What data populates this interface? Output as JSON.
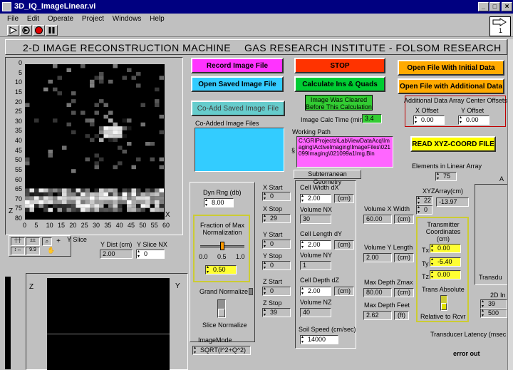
{
  "window": {
    "title": "3D_IQ_ImageLinear.vi",
    "controls": [
      "_",
      "□",
      "×"
    ]
  },
  "menu": [
    "File",
    "Edit",
    "Operate",
    "Project",
    "Windows",
    "Help"
  ],
  "connector_number": "1",
  "banner": {
    "left": "2-D IMAGE RECONSTRUCTION MACHINE",
    "right": "GAS RESEARCH INSTITUTE - FOLSOM RESEARCH"
  },
  "graph": {
    "y_ticks": [
      "0",
      "5",
      "10",
      "15",
      "20",
      "25",
      "30",
      "35",
      "40",
      "45",
      "50",
      "55",
      "60",
      "65",
      "70",
      "75",
      "80"
    ],
    "x_ticks": [
      "0",
      "5",
      "10",
      "15",
      "20",
      "25",
      "30",
      "35",
      "40",
      "45",
      "50",
      "55",
      "60"
    ],
    "x_axis": "X",
    "z_axis": "Z",
    "y_slice_label": "Y Slice",
    "y_dist_label": "Y Dist (cm)",
    "y_dist_value": "2.00",
    "y_slice_nx_label": "Y Slice NX",
    "y_slice_nx_value": "0"
  },
  "lower_graph": {
    "z_axis": "Z",
    "y_axis": "Y"
  },
  "buttons": {
    "record": "Record Image File",
    "stop": "STOP",
    "open_initial": "Open File With Initial Data",
    "open_saved": "Open Saved Image File",
    "calculate": "Calculate Ins & Quads",
    "open_additional": "Open File with Additional Data",
    "co_add": "Co-Add Saved Image File",
    "read_xyz": "READ XYZ-COORD FILE"
  },
  "image_cleared": "Image Was Cleared Before This Calculation",
  "image_calc_time_label": "Image Calc Time (min)",
  "image_calc_time_value": "3.4",
  "co_added_label": "Co-Added Image Files",
  "working_path_label": "Working Path",
  "working_path_value": "C:\\GRIProjects\\LabViewDataAcq\\Imaging\\ActiveImaging\\ImageFiles\\021099Imaging\\021099a1Img.Bin",
  "offsets": {
    "title": "Additional Data Array Center Offsets",
    "x_label": "X Offset",
    "x_value": "0.00",
    "y_label": "Y Offset",
    "y_value": "0.00"
  },
  "elements_label": "Elements in Linear Array",
  "elements_value": "75",
  "xyz_array_label": "XYZArray(cm)",
  "xyz_index_1": "22",
  "xyz_index_2": "0",
  "xyz_value": "-13.97",
  "dyn_rng_label": "Dyn Rng (db)",
  "dyn_rng_value": "8.00",
  "fraction": {
    "title": "Fraction of Max Normalization",
    "ticks": [
      "0.0",
      "0.5",
      "1.0"
    ],
    "value": "0.50",
    "fraction_value": 0.5
  },
  "grand_normalize": "Grand Normalize",
  "slice_normalize": "Slice Normalize",
  "image_mode_label": "ImageMode",
  "image_mode_value": "SQRT(I^2+Q^2)",
  "xyz_ranges": {
    "x_start_label": "X Start",
    "x_start": "0",
    "x_stop_label": "X Stop",
    "x_stop": "29",
    "y_start_label": "Y Start",
    "y_start": "0",
    "y_stop_label": "Y Stop",
    "y_stop": "0",
    "z_start_label": "Z Start",
    "z_start": "0",
    "z_stop_label": "Z Stop",
    "z_stop": "39"
  },
  "geometry": {
    "title": "Subterranean Geometry",
    "cell_width_label": "Cell Width dX",
    "cell_width": "2.00",
    "volume_nx_label": "Volume NX",
    "volume_nx": "30",
    "cell_length_label": "Cell Length dY",
    "cell_length": "2.00",
    "volume_ny_label": "Volume NY",
    "volume_ny": "1",
    "cell_depth_label": "Cell Depth dZ",
    "cell_depth": "2.00",
    "volume_nz_label": "Volume NZ",
    "volume_nz": "40",
    "soil_speed_label": "Soil Speed (cm/sec)",
    "soil_speed": "14000",
    "unit_cm": "(cm)"
  },
  "volume": {
    "x_width_label": "Volume X Width",
    "x_width": "60.00",
    "y_length_label": "Volume Y Length",
    "y_length": "2.00",
    "max_depth_z_label": "Max Depth Zmax",
    "max_depth_z": "80.00",
    "max_depth_ft_label": "Max Depth Feet",
    "max_depth_ft": "2.62",
    "unit_cm": "(cm)",
    "unit_ft": "(ft)"
  },
  "transmitter": {
    "title": "Transmitter Coordinates (cm)",
    "tx_label": "Tx",
    "tx": "0.00",
    "ty_label": "Ty",
    "ty": "-5.40",
    "tz_label": "Tz",
    "tz": "0.00",
    "trans_absolute": "Trans Absolute",
    "relative": "Relative to Rcvr"
  },
  "transducer_latency": "Transducer Latency (msec",
  "error_out": "error out",
  "right_edge": {
    "a_label": "A",
    "transdu": "Transdu",
    "im_2d": "2D In",
    "val_39": "39",
    "val_500": "500"
  }
}
